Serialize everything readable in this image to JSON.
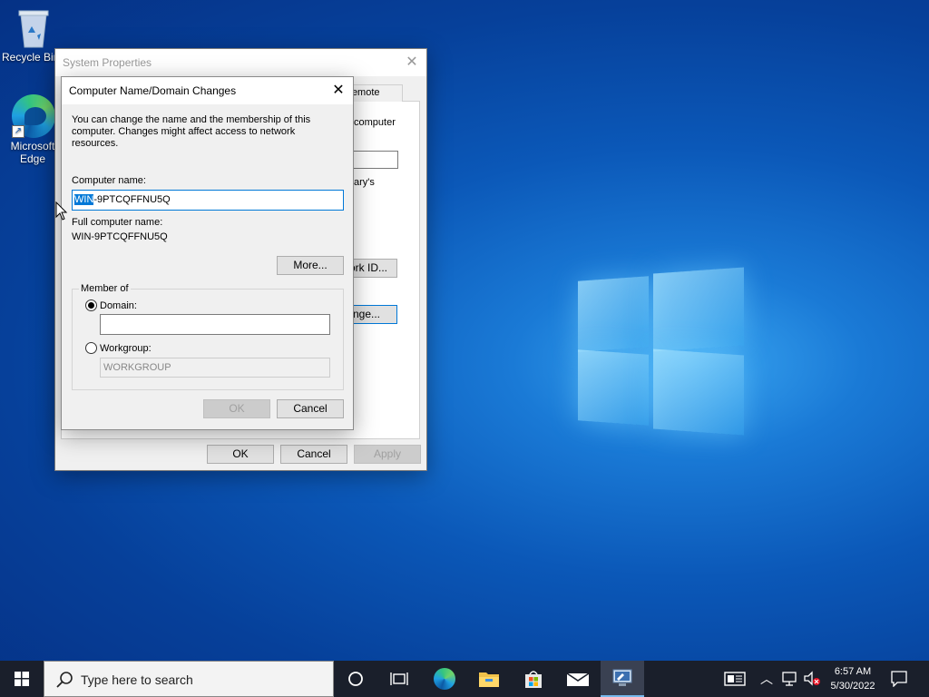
{
  "desktop": {
    "icons": [
      {
        "label": "Recycle Bin"
      },
      {
        "label": "Microsoft Edge"
      }
    ]
  },
  "system_properties": {
    "title": "System Properties",
    "tab_remote": "Remote",
    "partial_text_1": "computer",
    "partial_text_2": "ary's",
    "network_id_button": "ork ID...",
    "change_button": "nge...",
    "ok_label": "OK",
    "cancel_label": "Cancel",
    "apply_label": "Apply"
  },
  "dialog": {
    "title": "Computer Name/Domain Changes",
    "description": "You can change the name and the membership of this computer. Changes might affect access to network resources.",
    "computer_name_label": "Computer name:",
    "computer_name_selected": "WIN",
    "computer_name_rest": "-9PTCQFFNU5Q",
    "full_name_label": "Full computer name:",
    "full_name_value": "WIN-9PTCQFFNU5Q",
    "more_button": "More...",
    "member_of_label": "Member of",
    "domain_label": "Domain:",
    "domain_value": "",
    "workgroup_label": "Workgroup:",
    "workgroup_value": "WORKGROUP",
    "selected_membership": "domain",
    "ok_label": "OK",
    "cancel_label": "Cancel"
  },
  "taskbar": {
    "search_placeholder": "Type here to search",
    "time": "6:57 AM",
    "date": "5/30/2022"
  },
  "colors": {
    "selection": "#0078d7",
    "taskbar": "#1a1f2b"
  }
}
